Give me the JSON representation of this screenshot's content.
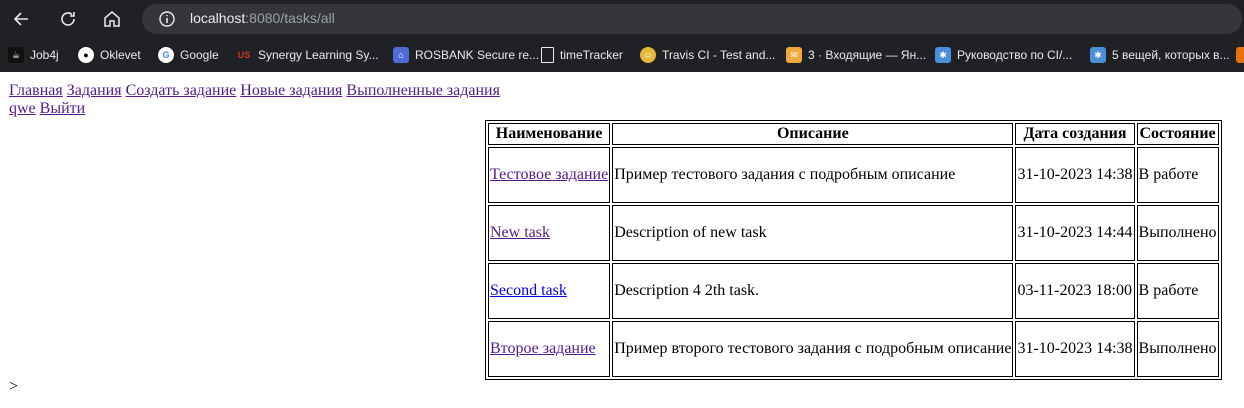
{
  "browser": {
    "url_host": "localhost",
    "url_rest": ":8080/tasks/all",
    "bookmarks": [
      {
        "label": "Job4j",
        "icon": "job4j-icon",
        "color": "#e8eaed"
      },
      {
        "label": "Oklevet",
        "icon": "github-icon",
        "color": "#ffffff"
      },
      {
        "label": "Google",
        "icon": "google-icon",
        "color": "#ea4335"
      },
      {
        "label": "Synergy Learning Sy...",
        "icon": "synergy-icon",
        "color": "#d93025"
      },
      {
        "label": "ROSBANK Secure re...",
        "icon": "rosbank-icon",
        "color": "#4f6bd8"
      },
      {
        "label": "timeTracker",
        "icon": "page-icon",
        "color": "#e8eaed"
      },
      {
        "label": "Travis CI - Test and...",
        "icon": "travis-icon",
        "color": "#e5b93a"
      },
      {
        "label": "3 · Входящие — Ян...",
        "icon": "mail-icon",
        "color": "#f2a93b"
      },
      {
        "label": "Руководство по CI/...",
        "icon": "ci-icon",
        "color": "#4a90d9"
      },
      {
        "label": "5 вещей, которых в...",
        "icon": "ci-icon",
        "color": "#4a90d9"
      }
    ]
  },
  "nav": {
    "home": "Главная",
    "tasks": "Задания",
    "create": "Создать задание",
    "new_tasks": "Новые задания",
    "done_tasks": "Выполненные задания",
    "user": "qwe",
    "logout": "Выйти"
  },
  "table": {
    "headers": [
      "Наименование",
      "Описание",
      "Дата создания",
      "Состояние"
    ],
    "rows": [
      {
        "name": "Тестовое задание",
        "description": "Пример тестового задания с подробным описание",
        "created": "31-10-2023 14:38",
        "status": "В работе"
      },
      {
        "name": "New task",
        "description": "Description of new task",
        "created": "31-10-2023 14:44",
        "status": "Выполнено"
      },
      {
        "name": "Second task",
        "description": "Description 4 2th task.",
        "created": "03-11-2023 18:00",
        "status": "В работе"
      },
      {
        "name": "Второе задание",
        "description": "Пример второго тестового задания с подробным описание",
        "created": "31-10-2023 14:38",
        "status": "Выполнено"
      }
    ]
  },
  "footer_text": ">"
}
